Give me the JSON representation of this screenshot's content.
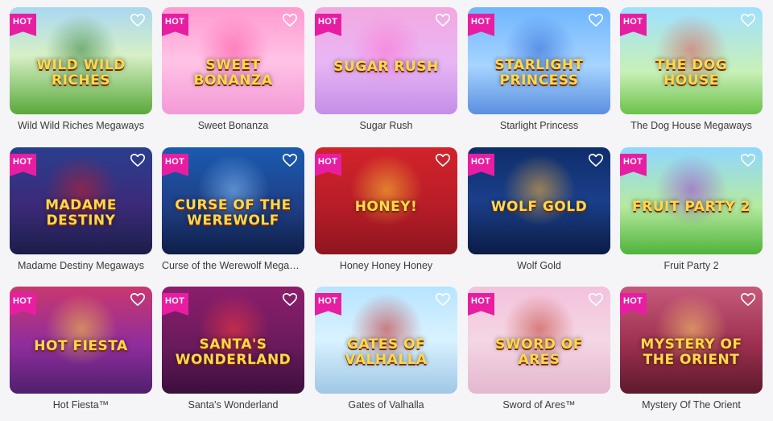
{
  "badge_label": "HOT",
  "games": [
    {
      "name": "Wild Wild Riches Megaways",
      "logo": "Wild Wild Riches",
      "bg": "linear-gradient(180deg,#a9d7f2 0%,#d7f0c6 45%,#5aa83b 100%)",
      "accent": "#2e7d32"
    },
    {
      "name": "Sweet Bonanza",
      "logo": "Sweet Bonanza",
      "bg": "linear-gradient(180deg,#ff9ad0 0%,#ffc3e6 50%,#f39ad6 100%)",
      "accent": "#ff4fa0"
    },
    {
      "name": "Sugar Rush",
      "logo": "Sugar Rush",
      "bg": "linear-gradient(180deg,#f3a8e0 0%,#e9b6f4 50%,#c58ee8 100%)",
      "accent": "#ff6ed2"
    },
    {
      "name": "Starlight Princess",
      "logo": "Starlight Princess",
      "bg": "linear-gradient(180deg,#6fb6ff 0%,#a6d4ff 55%,#5a8fe0 100%)",
      "accent": "#2a63d3"
    },
    {
      "name": "The Dog House Megaways",
      "logo": "The Dog House",
      "bg": "linear-gradient(180deg,#9fe0ff 0%,#c9f0b8 60%,#6cc24a 100%)",
      "accent": "#d9534f"
    },
    {
      "name": "Madame Destiny Megaways",
      "logo": "Madame Destiny",
      "bg": "linear-gradient(180deg,#2a3e8f 0%,#3c2a78 55%,#1a1e4a 100%)",
      "accent": "#c71f2a"
    },
    {
      "name": "Curse of the Werewolf Megaways",
      "logo": "Curse of the Werewolf",
      "bg": "linear-gradient(180deg,#1a5bb0 0%,#1f3f86 55%,#0e1f47 100%)",
      "accent": "#89c8ff"
    },
    {
      "name": "Honey Honey Honey",
      "logo": "Honey!",
      "bg": "linear-gradient(180deg,#d2232a 0%,#b81d28 55%,#8e1520 100%)",
      "accent": "#ffcf33"
    },
    {
      "name": "Wolf Gold",
      "logo": "Wolf Gold",
      "bg": "linear-gradient(180deg,#0f2d6b 0%,#1a3f8a 50%,#0b1c45 100%)",
      "accent": "#ffb938"
    },
    {
      "name": "Fruit Party 2",
      "logo": "Fruit Party 2",
      "bg": "linear-gradient(180deg,#8fd7ff 0%,#b6eaa0 55%,#4fb33a 100%)",
      "accent": "#9b39d1"
    },
    {
      "name": "Hot Fiesta™",
      "logo": "Hot Fiesta",
      "bg": "linear-gradient(180deg,#c9386f 0%,#8f2d9c 55%,#4f1f6e 100%)",
      "accent": "#ffd23a"
    },
    {
      "name": "Santa's Wonderland",
      "logo": "Santa's Wonderland",
      "bg": "linear-gradient(180deg,#8c1e6c 0%,#6a1a5d 55%,#3c0f3c 100%)",
      "accent": "#ff3a3a"
    },
    {
      "name": "Gates of Valhalla",
      "logo": "Gates of Valhalla",
      "bg": "linear-gradient(180deg,#b7e4ff 0%,#d9f2ff 50%,#9fc7e6 100%)",
      "accent": "#c21e1e"
    },
    {
      "name": "Sword of Ares™",
      "logo": "Sword of Ares",
      "bg": "linear-gradient(180deg,#f3c2dc 0%,#f4d6e4 50%,#e4b7cf 100%)",
      "accent": "#c0392b"
    },
    {
      "name": "Mystery Of The Orient",
      "logo": "Mystery of the Orient",
      "bg": "linear-gradient(180deg,#c65a7b 0%,#9c2f4f 55%,#5d1a2c 100%)",
      "accent": "#ffd36b"
    }
  ]
}
